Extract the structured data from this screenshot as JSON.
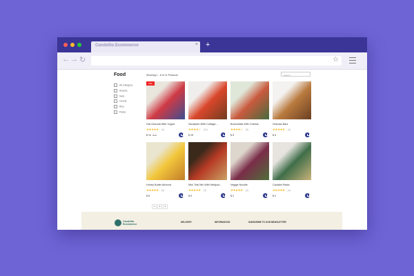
{
  "browser": {
    "tab_title": "Candelita Ecommerce",
    "tab_close": "×",
    "new_tab": "+",
    "back": "←",
    "forward": "→",
    "reload": "↻",
    "bookmark": "☆"
  },
  "sidebar": {
    "title": "Food",
    "categories": [
      "All Category",
      "Snacks",
      "Nuts",
      "Cereal",
      "Rice",
      "Pasta"
    ]
  },
  "listing": {
    "showing": "Showing 1 - 8 of 11 Products",
    "search_placeholder": "Search"
  },
  "products": [
    {
      "name": "Oat Granola With Yogurt",
      "stars": "★★★★★",
      "rating": "(4)",
      "price": "$ 10",
      "old_price": "$15",
      "badge": "Sale",
      "colors": [
        "#e9e6de",
        "#cf3a44",
        "#3d4d92"
      ]
    },
    {
      "name": "Sandwich With Cottage...",
      "stars": "★★★★☆",
      "rating": "(10)",
      "price": "$ 15",
      "old_price": "",
      "badge": "",
      "colors": [
        "#efeeec",
        "#d9462a",
        "#6f3d22"
      ]
    },
    {
      "name": "Bruschetta With Cheese",
      "stars": "★★★★☆",
      "rating": "(5)",
      "price": "$ 5",
      "old_price": "",
      "badge": "",
      "colors": [
        "#dfe7d9",
        "#c95a3d",
        "#456b3e"
      ]
    },
    {
      "name": "Granola Bars",
      "stars": "★★★★★",
      "rating": "(4)",
      "price": "$ 5",
      "old_price": "",
      "badge": "",
      "colors": [
        "#f4f2f0",
        "#b97a3e",
        "#6a3f22"
      ]
    },
    {
      "name": "Honey Butter Almond",
      "stars": "★★★★★",
      "rating": "(6)",
      "price": "$ 8",
      "old_price": "",
      "badge": "",
      "colors": [
        "#e9e5cf",
        "#f2c63b",
        "#c27c2a"
      ]
    },
    {
      "name": "Mini Trail Mix With Medjool...",
      "stars": "★★★★★",
      "rating": "(4)",
      "price": "$ 5",
      "old_price": "",
      "badge": "",
      "colors": [
        "#3b2a1c",
        "#b63a24",
        "#caa265"
      ]
    },
    {
      "name": "Veggie Noodle",
      "stars": "★★★★★",
      "rating": "(4)",
      "price": "$ 2",
      "old_price": "",
      "badge": "",
      "colors": [
        "#ddd6cd",
        "#7a2d48",
        "#4f6f3a"
      ]
    },
    {
      "name": "Cavatini Pasta",
      "stars": "★★★★★",
      "rating": "(4)",
      "price": "$ 4",
      "old_price": "",
      "badge": "",
      "colors": [
        "#e7e4df",
        "#3f6e49",
        "#c9b27a"
      ]
    }
  ],
  "pagination": {
    "pages": [
      "1",
      "2",
      "3"
    ]
  },
  "footer": {
    "brand": "Candelita",
    "brand_sub": "Ecommerce",
    "delivery": "DELIVERY",
    "information": "INFORMATION",
    "newsletter": "SUBSCRIBE TO OUR NEWSLETTER"
  }
}
